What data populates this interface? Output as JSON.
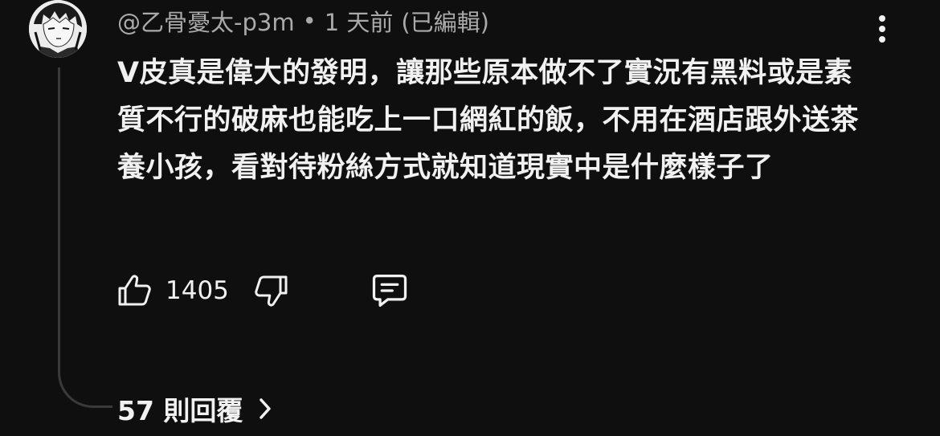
{
  "comment": {
    "author": "@乙骨憂太-p3m",
    "separator": "•",
    "timestamp": "1 天前",
    "edited": "(已編輯)",
    "text": "V皮真是偉大的發明，讓那些原本做不了實況有黑料或是素質不行的破麻也能吃上一口網紅的飯，不用在酒店跟外送茶養小孩，看對待粉絲方式就知道現實中是什麼樣子了",
    "like_count": "1405",
    "replies_label": "57 則回覆"
  },
  "icons": {
    "avatar": "anime-avatar",
    "more": "more-vert-icon",
    "like": "thumb-up-icon",
    "dislike": "thumb-down-icon",
    "reply": "reply-comment-icon",
    "chevron": "chevron-right-icon"
  },
  "colors": {
    "background": "#0f0f0f",
    "text_primary": "#f1f1f1",
    "text_secondary": "#aaaaaa",
    "thread_line": "#3a3a3a"
  }
}
